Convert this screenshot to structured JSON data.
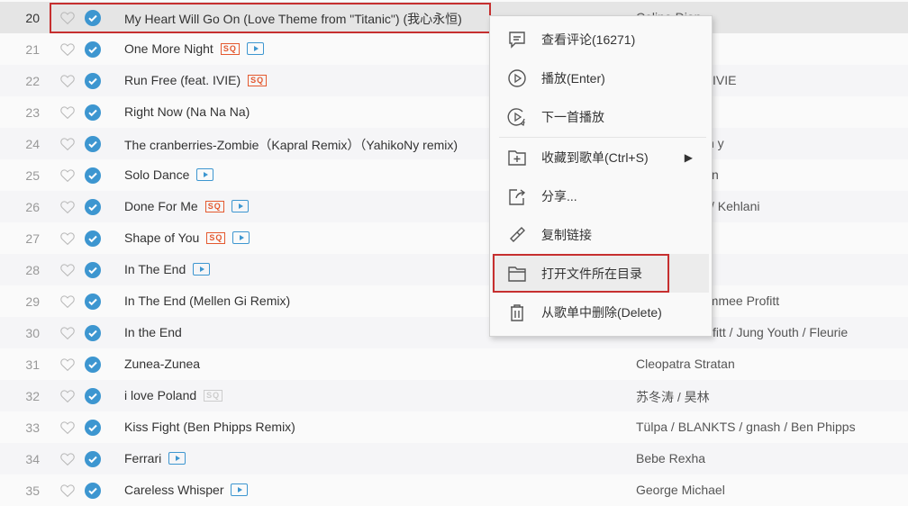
{
  "colors": {
    "accent": "#c62f2f",
    "check": "#3d96d0",
    "sq": "#e4592f"
  },
  "songs": [
    {
      "num": "20",
      "title": "My Heart Will Go On (Love Theme from \"Titanic\")  (我心永恒)",
      "tags": [],
      "artist": "Celine Dion",
      "selected": true
    },
    {
      "num": "21",
      "title": "One More Night",
      "tags": [
        "sq",
        "mv"
      ],
      "artist": ""
    },
    {
      "num": "22",
      "title": "Run Free (feat. IVIE)",
      "tags": [
        "sq"
      ],
      "artist": "IVIE"
    },
    {
      "num": "23",
      "title": "Right Now (Na Na Na)",
      "tags": [],
      "artist": ""
    },
    {
      "num": "24",
      "title": "The cranberries-Zombie（Kapral Remix）（YahikoNy remix)",
      "tags": [],
      "artist": "n y"
    },
    {
      "num": "25",
      "title": "Solo Dance",
      "tags": [
        "mv"
      ],
      "artist": "n"
    },
    {
      "num": "26",
      "title": "Done For Me",
      "tags": [
        "sq",
        "mv"
      ],
      "artist": "/ Kehlani"
    },
    {
      "num": "27",
      "title": "Shape of You",
      "tags": [
        "sq",
        "mv"
      ],
      "artist": ""
    },
    {
      "num": "28",
      "title": "In The End",
      "tags": [
        "mv"
      ],
      "artist": ""
    },
    {
      "num": "29",
      "title": "In The End (Mellen Gi Remix)",
      "tags": [],
      "artist": "ommee Profitt"
    },
    {
      "num": "30",
      "title": "In the End",
      "tags": [],
      "artist": "fitt / Jung Youth / Fleurie"
    },
    {
      "num": "31",
      "title": "Zunea-Zunea",
      "tags": [],
      "artist": "Cleopatra Stratan"
    },
    {
      "num": "32",
      "title": "i love Poland",
      "tags": [
        "sq-gray"
      ],
      "artist": "苏冬涛 / 昊林"
    },
    {
      "num": "33",
      "title": "Kiss Fight (Ben Phipps Remix)",
      "tags": [],
      "artist": "Tülpa / BLANKTS / gnash / Ben Phipps"
    },
    {
      "num": "34",
      "title": "Ferrari",
      "tags": [
        "mv"
      ],
      "artist": "Bebe Rexha"
    },
    {
      "num": "35",
      "title": "Careless Whisper",
      "tags": [
        "mv"
      ],
      "artist": "George Michael"
    }
  ],
  "tag_labels": {
    "sq": "SQ"
  },
  "menu": {
    "items": [
      {
        "id": "comments",
        "icon": "comment-icon",
        "label": "查看评论(16271)"
      },
      {
        "id": "play",
        "icon": "play-icon",
        "label": "播放(Enter)"
      },
      {
        "id": "play-next",
        "icon": "play-next-icon",
        "label": "下一首播放"
      },
      {
        "id": "collect",
        "icon": "folder-add-icon",
        "label": "收藏到歌单(Ctrl+S)",
        "submenu": true
      },
      {
        "id": "share",
        "icon": "share-icon",
        "label": "分享..."
      },
      {
        "id": "copy-link",
        "icon": "link-icon",
        "label": "复制链接"
      },
      {
        "id": "open-folder",
        "icon": "folder-icon",
        "label": "打开文件所在目录",
        "hovered": true
      },
      {
        "id": "delete",
        "icon": "trash-icon",
        "label": "从歌单中删除(Delete)"
      }
    ]
  }
}
